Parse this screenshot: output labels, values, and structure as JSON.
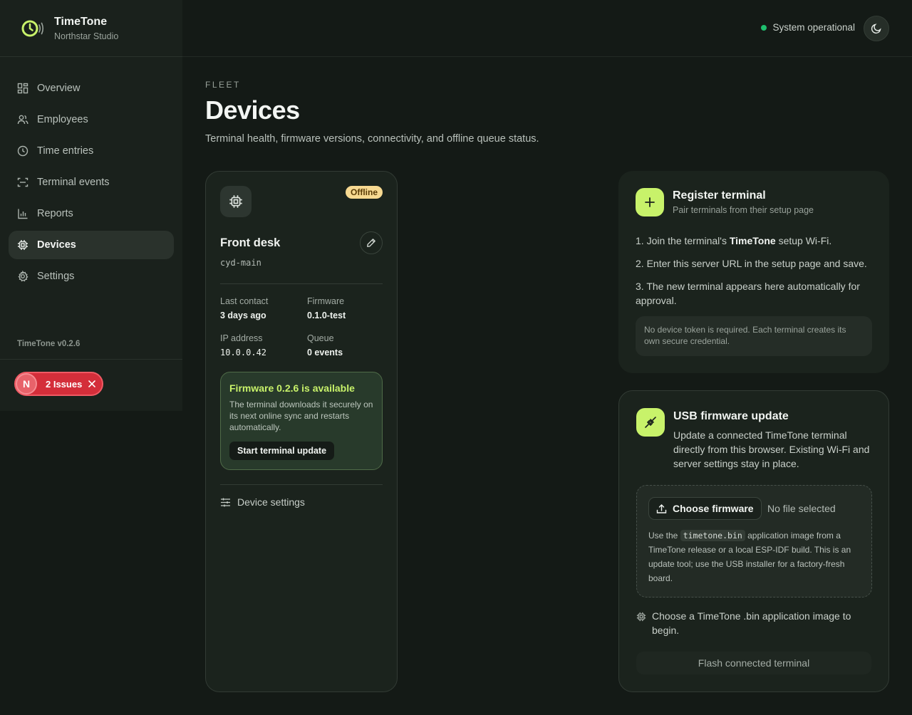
{
  "app": {
    "name": "TimeTone",
    "org": "Northstar Studio",
    "version": "TimeTone v0.2.6"
  },
  "sidebar": {
    "items": [
      {
        "label": "Overview",
        "icon": "dashboard-icon"
      },
      {
        "label": "Employees",
        "icon": "users-icon"
      },
      {
        "label": "Time entries",
        "icon": "clock-icon"
      },
      {
        "label": "Terminal events",
        "icon": "scan-icon"
      },
      {
        "label": "Reports",
        "icon": "bar-chart-icon"
      },
      {
        "label": "Devices",
        "icon": "chip-icon",
        "active": true
      },
      {
        "label": "Settings",
        "icon": "gear-icon"
      }
    ]
  },
  "issues": {
    "avatar": "N",
    "label": "2 Issues"
  },
  "topbar": {
    "status": "System operational",
    "status_color": "#1fbf6e",
    "theme_icon": "moon-icon"
  },
  "page": {
    "eyebrow": "FLEET",
    "title": "Devices",
    "subtitle": "Terminal health, firmware versions, connectivity, and offline queue status."
  },
  "device": {
    "status": "Offline",
    "name": "Front desk",
    "id": "cyd-main",
    "last_contact_label": "Last contact",
    "last_contact": "3 days ago",
    "firmware_label": "Firmware",
    "firmware": "0.1.0-test",
    "ip_label": "IP address",
    "ip": "10.0.0.42",
    "queue_label": "Queue",
    "queue": "0 events",
    "update": {
      "title": "Firmware 0.2.6 is available",
      "description": "The terminal downloads it securely on its next online sync and restarts automatically.",
      "button": "Start terminal update"
    },
    "settings_label": "Device settings"
  },
  "register": {
    "title": "Register terminal",
    "subtitle": "Pair terminals from their setup page",
    "step1_pre": "1. Join the terminal's ",
    "step1_bold": "TimeTone",
    "step1_post": " setup Wi-Fi.",
    "step2": "2. Enter this server URL in the setup page and save.",
    "step3": "3. The new terminal appears here automatically for approval.",
    "note": "No device token is required. Each terminal creates its own secure credential."
  },
  "usb": {
    "title": "USB firmware update",
    "description": "Update a connected TimeTone terminal directly from this browser. Existing Wi-Fi and server settings stay in place.",
    "choose_button": "Choose firmware",
    "no_file": "No file selected",
    "help_pre": "Use the ",
    "help_code": "timetone.bin",
    "help_post": " application image from a TimeTone release or a local ESP-IDF build. This is an update tool; use the USB installer for a factory-fresh board.",
    "hint": "Choose a TimeTone .bin application image to begin.",
    "flash_button": "Flash connected terminal"
  },
  "colors": {
    "accent": "#c8f26a",
    "danger": "#d42e3a",
    "offline_badge": "#f7d991"
  }
}
